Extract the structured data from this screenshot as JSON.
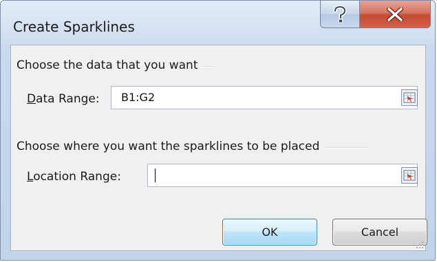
{
  "window": {
    "title": "Create Sparklines"
  },
  "titlebar": {
    "help_icon": "help-icon",
    "close_icon": "close-icon"
  },
  "data_group": {
    "heading": "Choose the data that you want",
    "field_label_mnemonic": "D",
    "field_label_rest": "ata Range:",
    "value": "B1:G2"
  },
  "location_group": {
    "heading": "Choose where you want the sparklines to be placed",
    "field_label_mnemonic": "L",
    "field_label_rest": "ocation Range:",
    "value": ""
  },
  "buttons": {
    "ok": "OK",
    "cancel": "Cancel"
  },
  "colors": {
    "close_red": "#c44a2f",
    "ok_border": "#3c7fb1"
  }
}
